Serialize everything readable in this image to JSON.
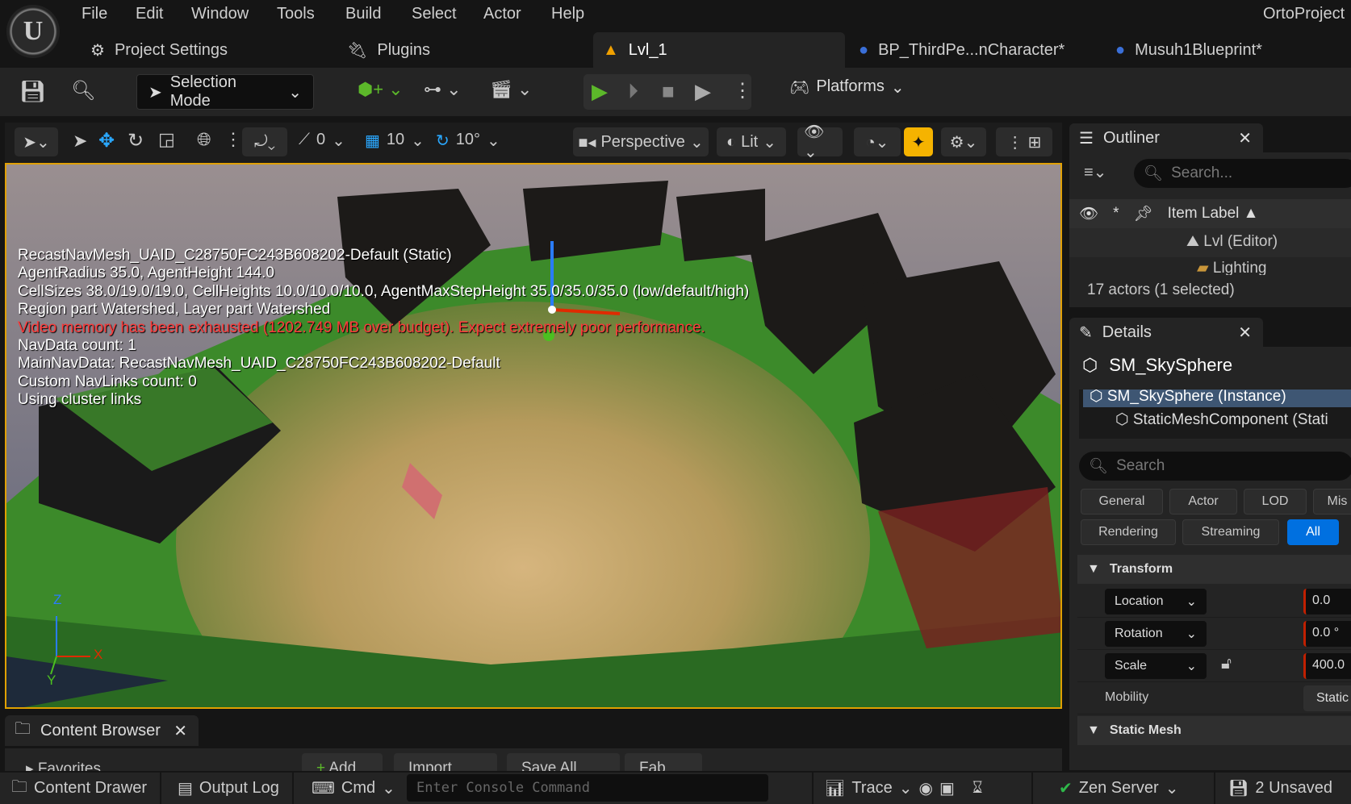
{
  "menu": [
    "File",
    "Edit",
    "Window",
    "Tools",
    "Build",
    "Select",
    "Actor",
    "Help"
  ],
  "project_name": "OrtoProject",
  "tabs": [
    {
      "label": "Project Settings",
      "icon": "settings-icon"
    },
    {
      "label": "Plugins",
      "icon": "plug-icon"
    },
    {
      "label": "Lvl_1",
      "icon": "level-icon"
    },
    {
      "label": "BP_ThirdPe...nCharacter*",
      "icon": "blueprint-icon"
    },
    {
      "label": "Musuh1Blueprint*",
      "icon": "blueprint-icon"
    }
  ],
  "toolbar": {
    "selection_mode": "Selection Mode",
    "platforms": "Platforms"
  },
  "viewport_toolbar": {
    "snap_translate": "0",
    "grid": "10",
    "rotate_snap": "10°",
    "view": "Perspective",
    "lit": "Lit"
  },
  "overlay": {
    "lines": [
      "RecastNavMesh_UAID_C28750FC243B608202-Default (Static)",
      "AgentRadius 35.0, AgentHeight 144.0",
      "CellSizes 38.0/19.0/19.0, CellHeights 10.0/10.0/10.0, AgentMaxStepHeight 35.0/35.0/35.0 (low/default/high)",
      "Region part Watershed, Layer part Watershed"
    ],
    "error": "Video memory has been exhausted (1202.749 MB over budget). Expect extremely poor performance.",
    "lines2": [
      "NavData count: 1",
      "MainNavData: RecastNavMesh_UAID_C28750FC243B608202-Default",
      "Custom NavLinks count: 0",
      "Using cluster links"
    ]
  },
  "axes": {
    "x": "X",
    "y": "Y",
    "z": "Z"
  },
  "outliner": {
    "title": "Outliner",
    "search_placeholder": "Search...",
    "column": "Item Label",
    "items": [
      "Lvl (Editor)",
      "Lighting"
    ],
    "count": "17 actors (1 selected)"
  },
  "details": {
    "title": "Details",
    "object": "SM_SkySphere",
    "tree": [
      "SM_SkySphere (Instance)",
      "StaticMeshComponent (Stati"
    ],
    "search_placeholder": "Search",
    "filters": [
      "General",
      "Actor",
      "LOD",
      "Mis",
      "Rendering",
      "Streaming",
      "All"
    ],
    "transform": "Transform",
    "rows": [
      {
        "label": "Location",
        "value": "0.0"
      },
      {
        "label": "Rotation",
        "value": "0.0 °"
      },
      {
        "label": "Scale",
        "value": "400.0"
      }
    ],
    "mobility_label": "Mobility",
    "mobility_value": "Static",
    "static_mesh": "Static Mesh"
  },
  "content_browser": {
    "title": "Content Browser",
    "favorites": "Favorites",
    "buttons": [
      "Add",
      "Import",
      "Save All",
      "Fab"
    ]
  },
  "status": {
    "content_drawer": "Content Drawer",
    "output_log": "Output Log",
    "cmd": "Cmd",
    "console_placeholder": "Enter Console Command",
    "trace": "Trace",
    "zen": "Zen Server",
    "unsaved": "2 Unsaved"
  },
  "colors": {
    "accent": "#0070e0",
    "viewport_border": "#e0a000",
    "error": "#ff3b3b",
    "play": "#5cb82a"
  }
}
